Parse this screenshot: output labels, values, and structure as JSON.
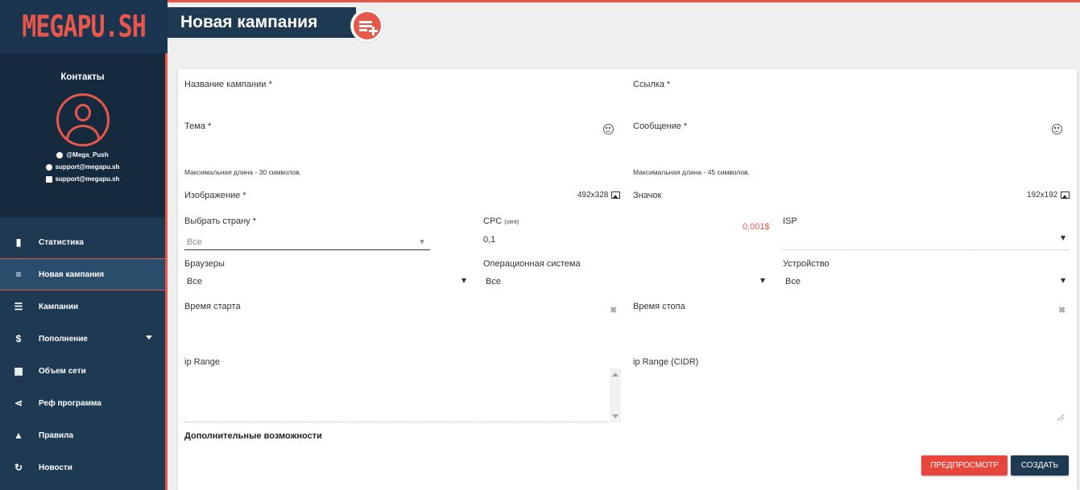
{
  "brand": {
    "logo_text": "MEGAPU.SH",
    "accent_color": "#e8574a",
    "sidebar_color": "#1e3a53"
  },
  "contacts": {
    "title": "Контакты",
    "telegram": "@Mega_Push",
    "skype": "support@megapu.sh",
    "email": "support@megapu.sh"
  },
  "nav": {
    "items": [
      {
        "label": "Статистика",
        "icon": "bar-chart-icon"
      },
      {
        "label": "Новая кампания",
        "icon": "playlist-add-icon",
        "active": true
      },
      {
        "label": "Кампании",
        "icon": "list-icon"
      },
      {
        "label": "Пополнение",
        "icon": "dollar-icon",
        "has_submenu": true
      },
      {
        "label": "Объем сети",
        "icon": "table-icon"
      },
      {
        "label": "Реф программа",
        "icon": "share-icon"
      },
      {
        "label": "Правила",
        "icon": "warning-icon"
      },
      {
        "label": "Новости",
        "icon": "refresh-icon"
      }
    ]
  },
  "header": {
    "title": "Новая кампания",
    "icon": "playlist-add-icon"
  },
  "form": {
    "campaign_name_label": "Название кампании *",
    "link_label": "Ссылка *",
    "subject_label": "Тема *",
    "subject_hint": "Максимальная длина - 30 символов.",
    "message_label": "Сообщение *",
    "message_hint": "Максимальная длина - 45 символов.",
    "image_label": "Изображение *",
    "image_size": "492x328",
    "icon_label": "Значок",
    "icon_size": "192x192",
    "country_label": "Выбрать страну *",
    "country_value": "Все",
    "cpc_label": "CPC",
    "cpc_unit": "(cent)",
    "cpc_value": "0,1",
    "cpc_price": "0,001$",
    "isp_label": "ISP",
    "isp_value": "",
    "browsers_label": "Браузеры",
    "browsers_value": "Все",
    "os_label": "Операционная система",
    "os_value": "Все",
    "device_label": "Устройство",
    "device_value": "Все",
    "start_time_label": "Время старта",
    "stop_time_label": "Время стопа",
    "ip_range_label": "ip Range",
    "ip_range_cidr_label": "ip Range (CIDR)",
    "extra_label": "Дополнительные возможности",
    "preview_button": "ПРЕДПРОСМОТР",
    "create_button": "СОЗДАТЬ"
  }
}
